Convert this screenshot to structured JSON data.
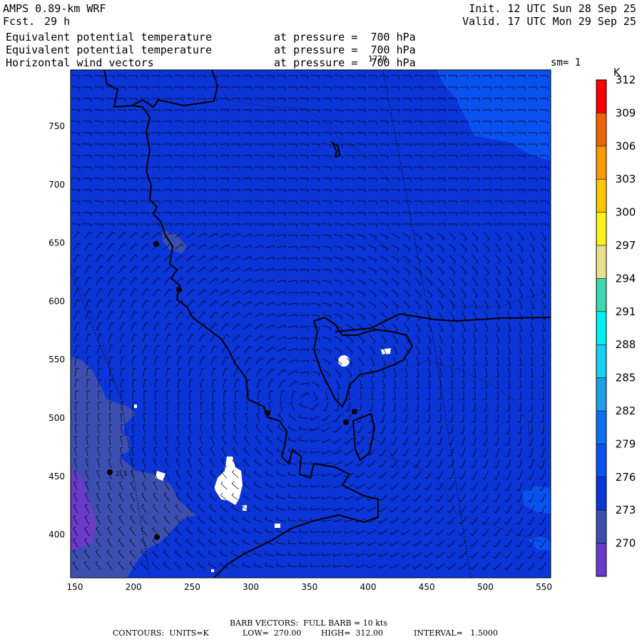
{
  "header": {
    "model": "AMPS 0.89-km WRF",
    "fcst_label": "Fcst.",
    "fcst_value": "29 h",
    "init": "Init. 12 UTC Sun 28 Sep 25",
    "valid": "Valid. 17 UTC Mon 29 Sep 25",
    "fields": [
      {
        "name": "Equivalent potential temperature",
        "level": "at pressure =  700 hPa"
      },
      {
        "name": "Equivalent potential temperature",
        "level": "at pressure =  700 hPa"
      },
      {
        "name": "Horizontal wind vectors",
        "level": "at pressure =  700 hPa"
      }
    ],
    "overlap_mark": "1770",
    "smoothing": "sm= 1"
  },
  "x_ticks": [
    "150",
    "200",
    "250",
    "300",
    "350",
    "400",
    "450",
    "500",
    "550"
  ],
  "y_ticks": [
    "750",
    "700",
    "650",
    "600",
    "550",
    "500",
    "450",
    "400"
  ],
  "map_labels": {
    "inline": "1.5"
  },
  "colorbar": {
    "unit": "K",
    "labels": [
      "270",
      "273",
      "276",
      "279",
      "282",
      "285",
      "288",
      "291",
      "294",
      "297",
      "300",
      "303",
      "306",
      "309",
      "312"
    ],
    "colors": [
      "#6a3ac8",
      "#3c4fb0",
      "#0c35d8",
      "#0a52f0",
      "#0a72f0",
      "#1ea0e6",
      "#18d0f0",
      "#00f0f0",
      "#3ed8b0",
      "#e8e08c",
      "#fff020",
      "#f8c800",
      "#f89a00",
      "#f06400",
      "#ff0000"
    ]
  },
  "footer": {
    "barb": "BARB VECTORS:  FULL BARB = 10 kts",
    "contours_label": "CONTOURS:  UNITS=K",
    "low": "LOW=  270.00",
    "high": "HIGH=  312.00",
    "interval": "INTERVAL=   1.5000"
  }
}
